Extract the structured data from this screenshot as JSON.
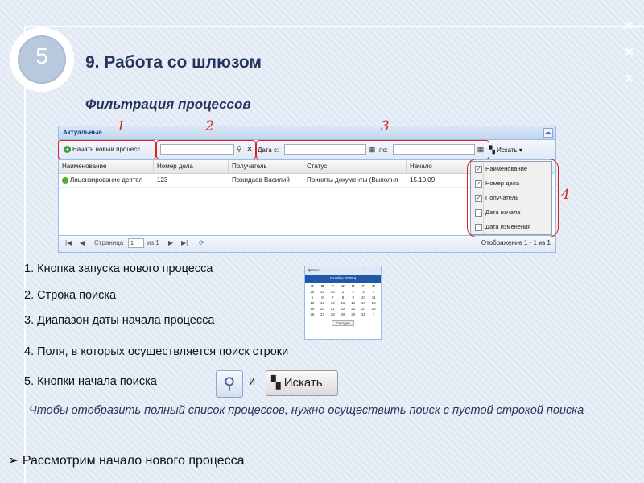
{
  "slide": {
    "number": "5",
    "title": "9. Работа со шлюзом",
    "subtitle": "Фильтрация процессов"
  },
  "panel": {
    "title": "Актуальные",
    "collapse_icon": "double-chevron-up-icon",
    "toolbar": {
      "new_process_label": "Начать новый процесс",
      "search_value": "",
      "date_from_label": "Дата с:",
      "date_to_label": "по:",
      "find_label": "Искать"
    },
    "columns": [
      "Наименование",
      "Номер дела",
      "Получатель",
      "Статус",
      "Начало"
    ],
    "rows": [
      {
        "name": "Лицензирование деятел",
        "case_number": "123",
        "recipient": "Пожидаев Василий",
        "status": "Приняты документы (Выполня",
        "start": "15.10.09"
      }
    ],
    "column_menu": [
      {
        "label": "Наименование",
        "checked": true
      },
      {
        "label": "Номер дела",
        "checked": true
      },
      {
        "label": "Получатель",
        "checked": true
      },
      {
        "label": "Дата начала",
        "checked": false
      },
      {
        "label": "Дата изменения",
        "checked": false
      }
    ],
    "paging": {
      "page_label": "Страница",
      "page_value": "1",
      "of_label": "из 1",
      "display_label": "Отображение 1 - 1 из 1"
    }
  },
  "markers": [
    "1",
    "2",
    "3",
    "4"
  ],
  "calendar": {
    "date_label": "Дата с:",
    "month_label": "Октябрь 2009 ▾",
    "weekdays": [
      "П",
      "В",
      "С",
      "Ч",
      "П",
      "С",
      "В"
    ],
    "days": [
      "28",
      "29",
      "30",
      "1",
      "2",
      "3",
      "4",
      "5",
      "6",
      "7",
      "8",
      "9",
      "10",
      "11",
      "12",
      "13",
      "14",
      "15",
      "16",
      "17",
      "18",
      "19",
      "20",
      "21",
      "22",
      "23",
      "24",
      "25",
      "26",
      "27",
      "28",
      "29",
      "30",
      "31",
      "1"
    ],
    "today_label": "Сегодня"
  },
  "list": {
    "item1": "1. Кнопка запуска нового процесса",
    "item2": "2. Строка поиска",
    "item3": "3. Диапазон даты начала процесса",
    "item4": "4. Поля, в которых осуществляется поиск строки",
    "item5": "5. Кнопки начала поиска",
    "and": "и",
    "find_button_label": "Искать"
  },
  "note": "Чтобы отобразить полный список процессов, нужно осуществить поиск с пустой строкой поиска",
  "footer": "Рассмотрим начало нового процесса",
  "colors": {
    "title": "#26355c",
    "marker": "#e02020",
    "panel_border": "#99bbe8"
  }
}
